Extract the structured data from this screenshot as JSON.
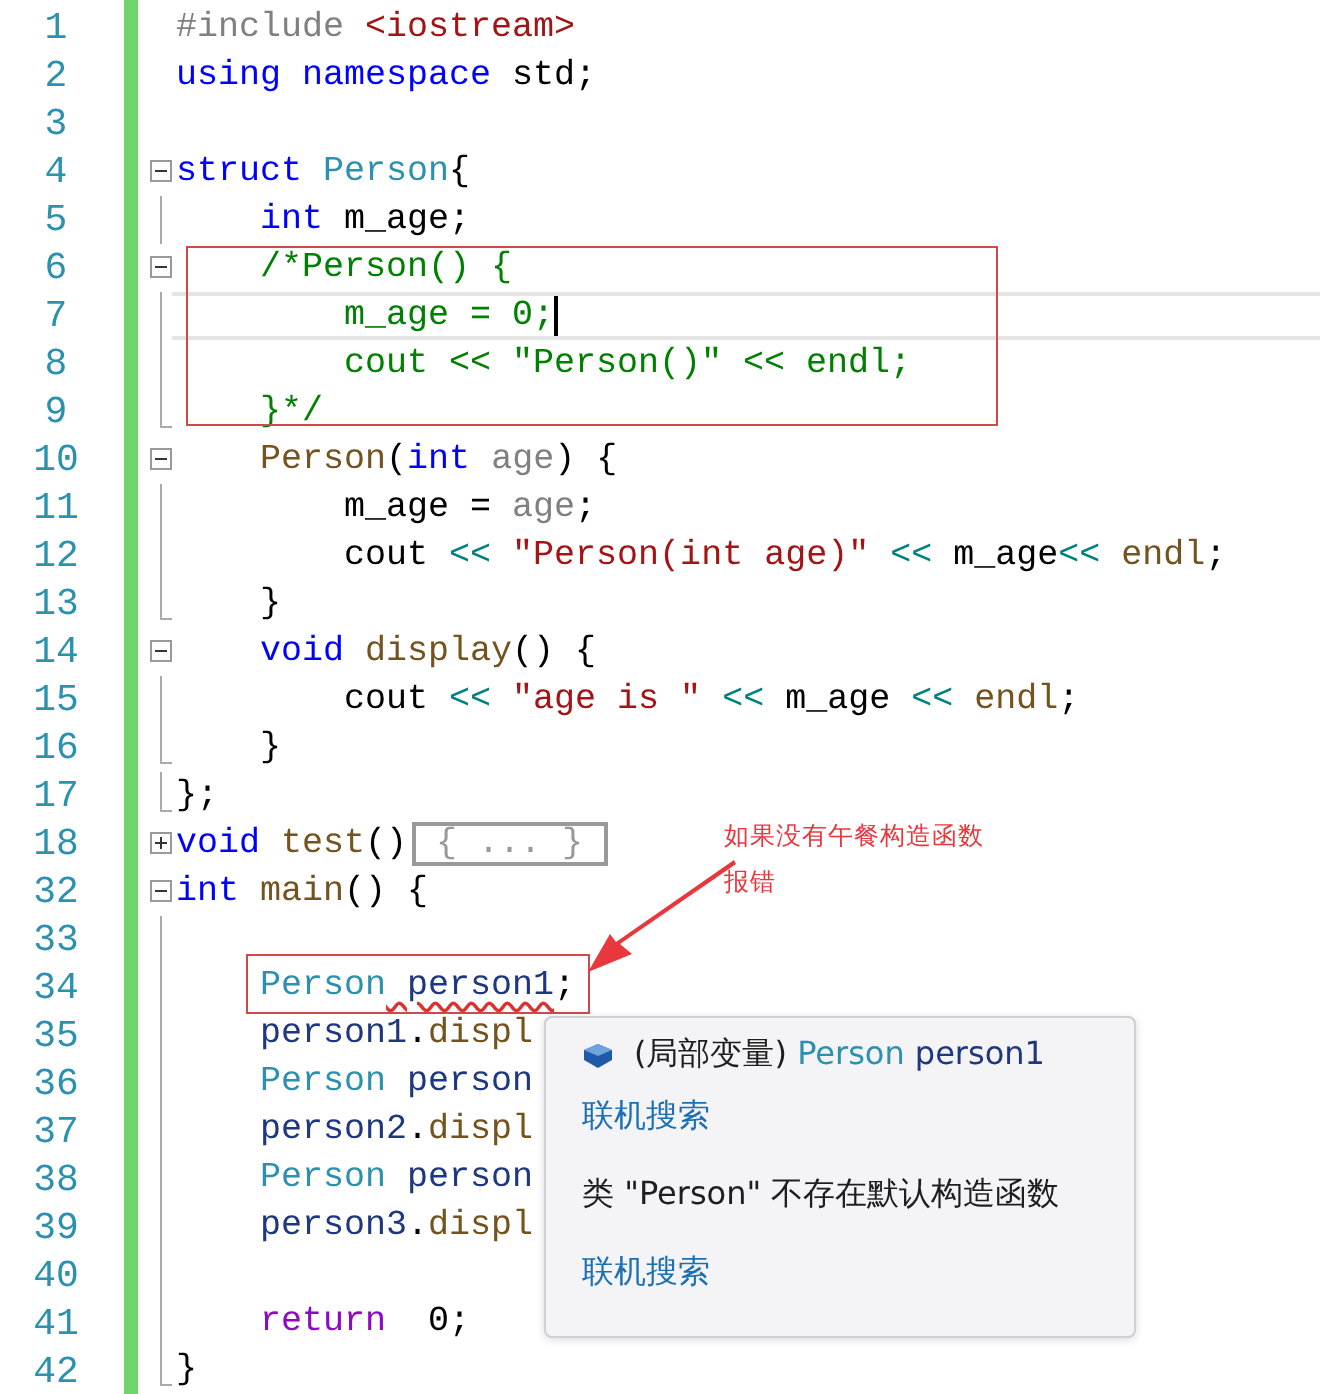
{
  "editor": {
    "lines": [
      {
        "number": "1",
        "kind": "none",
        "current": false,
        "tokens": [
          {
            "text": "#include",
            "kind": "preproc"
          },
          {
            "text": " <iostream>",
            "kind": "string"
          }
        ]
      },
      {
        "number": "2",
        "kind": "none",
        "current": false,
        "tokens": [
          {
            "text": "using namespace",
            "kind": "keyword"
          },
          {
            "text": " std;",
            "kind": "plain"
          }
        ]
      },
      {
        "number": "3",
        "kind": "none",
        "current": false
      },
      {
        "number": "4",
        "kind": "expanded-fold",
        "current": false,
        "tokens": [
          {
            "text": "struct",
            "kind": "keyword"
          },
          {
            "text": " Person",
            "kind": "type"
          },
          {
            "text": "{",
            "kind": "plain"
          }
        ]
      },
      {
        "number": "5",
        "kind": "fold-line",
        "current": false,
        "tokens": [
          {
            "text": "    int",
            "kind": "keyword"
          },
          {
            "text": " m_age;",
            "kind": "plain"
          }
        ]
      },
      {
        "number": "6",
        "kind": "expanded-fold",
        "current": false,
        "tokens": [
          {
            "text": "    /*Person() {",
            "kind": "comment"
          }
        ]
      },
      {
        "number": "7",
        "kind": "fold-line",
        "current": true,
        "tokens": [
          {
            "text": "        m_age = 0;",
            "kind": "comment"
          }
        ]
      },
      {
        "number": "8",
        "kind": "fold-line",
        "current": false,
        "tokens": [
          {
            "text": "        cout << \"Person()\" << endl;",
            "kind": "comment"
          }
        ]
      },
      {
        "number": "9",
        "kind": "fold-end",
        "current": false,
        "tokens": [
          {
            "text": "    }*/",
            "kind": "comment"
          }
        ]
      },
      {
        "number": "10",
        "kind": "expanded-fold",
        "current": false,
        "tokens": [
          {
            "text": "    Person",
            "kind": "function"
          },
          {
            "text": "(",
            "kind": "plain"
          },
          {
            "text": "int",
            "kind": "keyword"
          },
          {
            "text": " age",
            "kind": "param"
          },
          {
            "text": ") {",
            "kind": "plain"
          }
        ]
      },
      {
        "number": "11",
        "kind": "fold-line",
        "current": false,
        "tokens": [
          {
            "text": "        m_age =",
            "kind": "plain"
          },
          {
            "text": " age",
            "kind": "param"
          },
          {
            "text": ";",
            "kind": "plain"
          }
        ]
      },
      {
        "number": "12",
        "kind": "fold-line",
        "current": false,
        "tokens": [
          {
            "text": "        cout",
            "kind": "plain"
          },
          {
            "text": " <<",
            "kind": "operator"
          },
          {
            "text": " \"Person(int age)\"",
            "kind": "string"
          },
          {
            "text": " <<",
            "kind": "operator"
          },
          {
            "text": " m_age",
            "kind": "plain"
          },
          {
            "text": "<<",
            "kind": "operator"
          },
          {
            "text": " endl",
            "kind": "function"
          },
          {
            "text": ";",
            "kind": "plain"
          }
        ]
      },
      {
        "number": "13",
        "kind": "fold-end",
        "current": false,
        "tokens": [
          {
            "text": "    }",
            "kind": "plain"
          }
        ]
      },
      {
        "number": "14",
        "kind": "expanded-fold",
        "current": false,
        "tokens": [
          {
            "text": "    void",
            "kind": "keyword"
          },
          {
            "text": " display",
            "kind": "function"
          },
          {
            "text": "() {",
            "kind": "plain"
          }
        ]
      },
      {
        "number": "15",
        "kind": "fold-line",
        "current": false,
        "tokens": [
          {
            "text": "        cout",
            "kind": "plain"
          },
          {
            "text": " <<",
            "kind": "operator"
          },
          {
            "text": " \"age is \"",
            "kind": "string"
          },
          {
            "text": " <<",
            "kind": "operator"
          },
          {
            "text": " m_age",
            "kind": "plain"
          },
          {
            "text": " <<",
            "kind": "operator"
          },
          {
            "text": " endl",
            "kind": "function"
          },
          {
            "text": ";",
            "kind": "plain"
          }
        ]
      },
      {
        "number": "16",
        "kind": "fold-end",
        "current": false,
        "tokens": [
          {
            "text": "    }",
            "kind": "plain"
          }
        ]
      },
      {
        "number": "17",
        "kind": "fold-end",
        "current": false,
        "tokens": [
          {
            "text": "};",
            "kind": "plain"
          }
        ]
      },
      {
        "number": "18",
        "kind": "collapsed-fold",
        "current": false,
        "tokens": [
          {
            "text": "void",
            "kind": "keyword"
          },
          {
            "text": " test",
            "kind": "function"
          },
          {
            "text": "()",
            "kind": "plain"
          },
          {
            "text": " { ... } ",
            "kind": "collapsed"
          }
        ]
      },
      {
        "number": "32",
        "kind": "expanded-fold",
        "current": false,
        "tokens": [
          {
            "text": "int",
            "kind": "keyword"
          },
          {
            "text": " main",
            "kind": "function"
          },
          {
            "text": "() {",
            "kind": "plain"
          }
        ]
      },
      {
        "number": "33",
        "kind": "fold-line",
        "current": false
      },
      {
        "number": "34",
        "kind": "fold-line",
        "current": false,
        "tokens": [
          {
            "text": "    Person",
            "kind": "type"
          },
          {
            "text": " person1",
            "kind": "error"
          },
          {
            "text": ";",
            "kind": "plain"
          }
        ]
      },
      {
        "number": "35",
        "kind": "fold-line",
        "current": false,
        "tokens": [
          {
            "text": "    person1",
            "kind": "variable"
          },
          {
            "text": ".",
            "kind": "plain"
          },
          {
            "text": "displ",
            "kind": "function"
          }
        ]
      },
      {
        "number": "36",
        "kind": "fold-line",
        "current": false,
        "tokens": [
          {
            "text": "    Person",
            "kind": "type"
          },
          {
            "text": " person",
            "kind": "variable"
          }
        ]
      },
      {
        "number": "37",
        "kind": "fold-line",
        "current": false,
        "tokens": [
          {
            "text": "    person2",
            "kind": "variable"
          },
          {
            "text": ".",
            "kind": "plain"
          },
          {
            "text": "displ",
            "kind": "function"
          }
        ]
      },
      {
        "number": "38",
        "kind": "fold-line",
        "current": false,
        "tokens": [
          {
            "text": "    Person",
            "kind": "type"
          },
          {
            "text": " person",
            "kind": "variable"
          }
        ]
      },
      {
        "number": "39",
        "kind": "fold-line",
        "current": false,
        "tokens": [
          {
            "text": "    person3",
            "kind": "variable"
          },
          {
            "text": ".",
            "kind": "plain"
          },
          {
            "text": "displ",
            "kind": "function"
          }
        ]
      },
      {
        "number": "40",
        "kind": "fold-line",
        "current": false
      },
      {
        "number": "41",
        "kind": "fold-line",
        "current": false,
        "tokens": [
          {
            "text": "    return",
            "kind": "control"
          },
          {
            "text": "  0;",
            "kind": "plain"
          }
        ]
      },
      {
        "number": "42",
        "kind": "fold-end",
        "current": false,
        "tokens": [
          {
            "text": "}",
            "kind": "plain"
          }
        ]
      }
    ]
  },
  "annotation": {
    "lines": [
      "如果没有午餐构造函数",
      "报错"
    ]
  },
  "tooltip": {
    "header": [
      {
        "text": "(局部变量) ",
        "kind": "plain"
      },
      {
        "text": "Person",
        "kind": "type"
      },
      {
        "text": " person1",
        "kind": "variable"
      }
    ],
    "links": [
      "联机搜索",
      "联机搜索"
    ],
    "message": "类 \"Person\" 不存在默认构造函数"
  }
}
